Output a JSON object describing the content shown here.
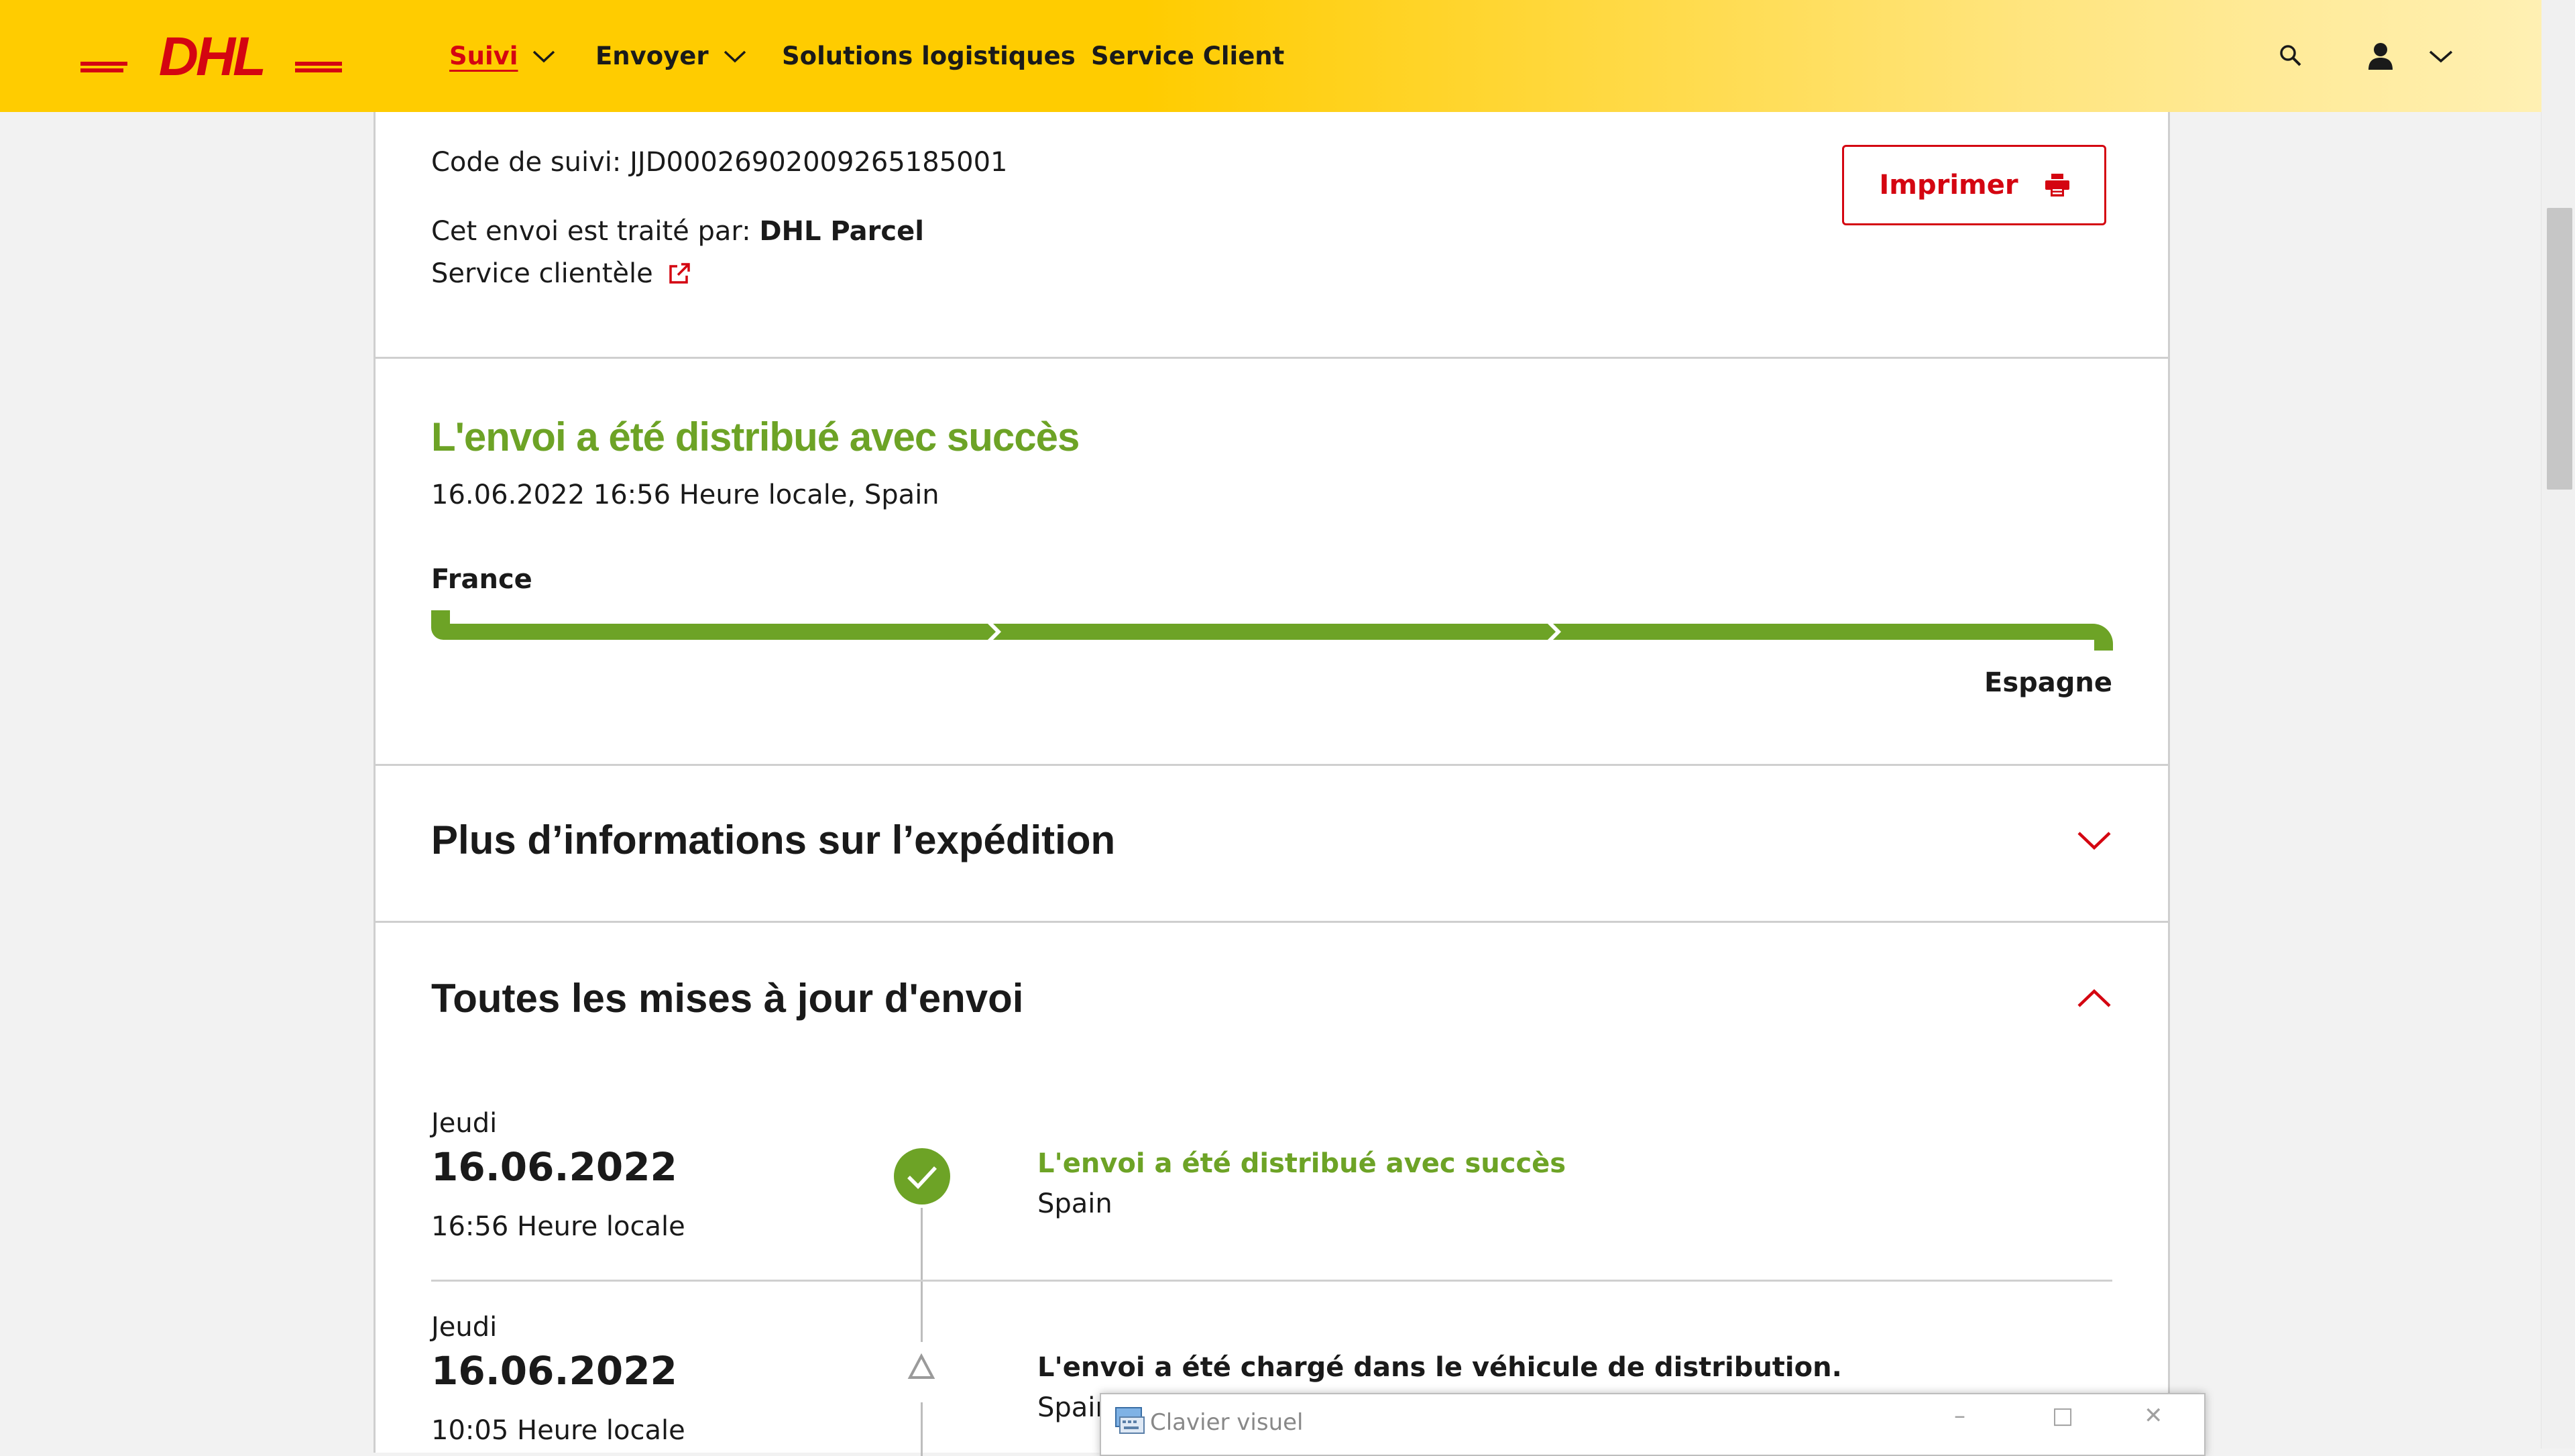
{
  "header": {
    "logo_text": "DHL",
    "nav": [
      {
        "label": "Suivi",
        "active": true,
        "has_dropdown": true
      },
      {
        "label": "Envoyer",
        "active": false,
        "has_dropdown": true
      },
      {
        "label": "Solutions logistiques",
        "active": false,
        "has_dropdown": false
      },
      {
        "label": "Service Client",
        "active": false,
        "has_dropdown": false
      }
    ],
    "icons": [
      "search-icon",
      "user-icon",
      "chevron-down-icon"
    ],
    "colors": {
      "yellow": "#ffcc00",
      "red": "#d40511"
    }
  },
  "tracking": {
    "code_line": "Code de suivi: JJD00026902009265185001",
    "handled_by_prefix": "Cet envoi est traité par: ",
    "handled_by_name": "DHL Parcel",
    "customer_service": "Service clientèle",
    "print_label": "Imprimer"
  },
  "status": {
    "title": "L'envoi a été distribué avec succès",
    "datetime": "16.06.2022 16:56 Heure locale, Spain",
    "origin": "France",
    "destination": "Espagne",
    "progress_segments_completed": 3,
    "progress_segments_total": 3,
    "color": "#6da326"
  },
  "more_info": {
    "title": "Plus d’informations sur l’expédition",
    "expanded": false
  },
  "updates": {
    "title": "Toutes les mises à jour d'envoi",
    "expanded": true,
    "events": [
      {
        "day": "Jeudi",
        "date": "16.06.2022",
        "time": "16:56 Heure locale",
        "description": "L'envoi a été distribué avec succès",
        "location": "Spain",
        "icon": "check-circle-icon"
      },
      {
        "day": "Jeudi",
        "date": "16.06.2022",
        "time": "10:05 Heure locale",
        "description": "L'envoi a été chargé dans le véhicule de distribution.",
        "location": "Spain",
        "icon": "triangle-icon"
      }
    ]
  },
  "osk": {
    "title": "Clavier visuel",
    "minimize": "–",
    "maximize": "□",
    "close": "✕"
  }
}
